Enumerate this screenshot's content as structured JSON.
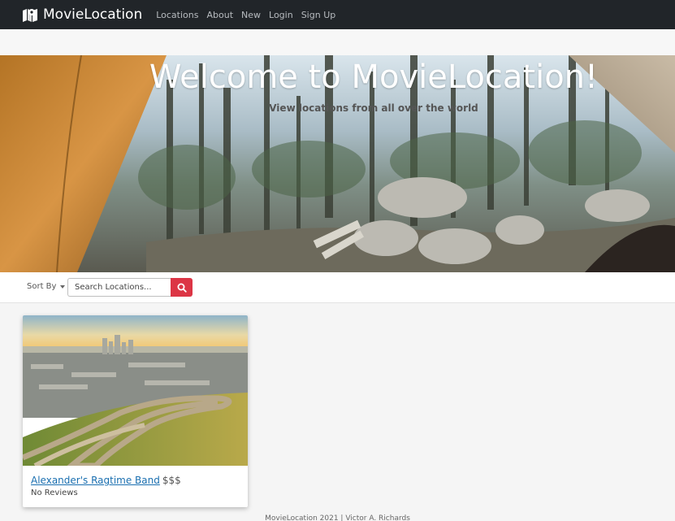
{
  "nav": {
    "brand": "MovieLocation",
    "brand_icon": "map-icon",
    "links": [
      "Locations",
      "About",
      "New",
      "Login",
      "Sign Up"
    ]
  },
  "hero": {
    "title": "Welcome to MovieLocation!",
    "subtitle": "View locations from all over the world"
  },
  "toolbar": {
    "sort_label": "Sort By",
    "search_placeholder": "Search Locations...",
    "search_icon": "search-icon"
  },
  "cards": [
    {
      "title": "Alexander's Ragtime Band",
      "price": "$$$",
      "reviews": "No Reviews"
    }
  ],
  "footer": {
    "text": "MovieLocation 2021 | Victor A. Richards"
  },
  "colors": {
    "navbar": "#212529",
    "search_button": "#dc3545",
    "link": "#1a6fb0"
  }
}
